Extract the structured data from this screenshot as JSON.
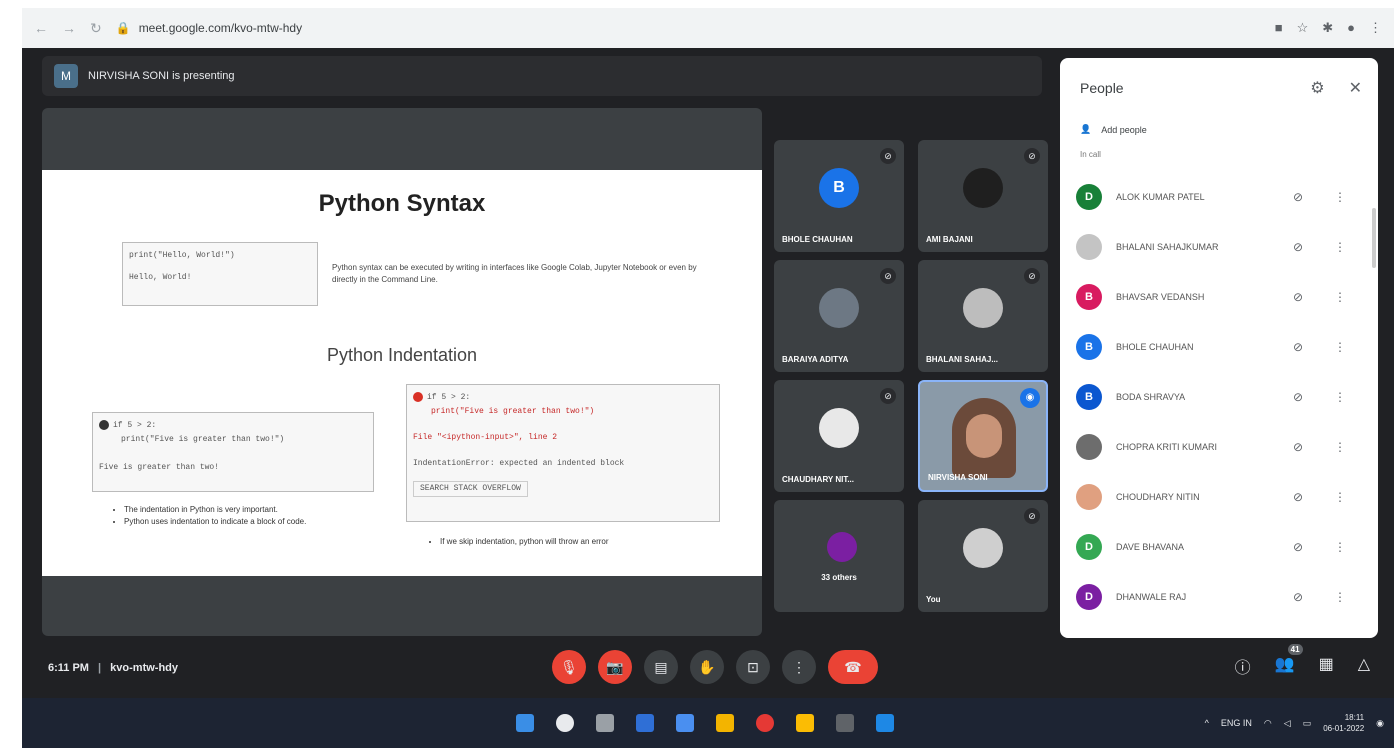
{
  "browser": {
    "url": "meet.google.com/kvo-mtw-hdy",
    "back": "←",
    "forward": "→",
    "reload": "↻"
  },
  "presenter": {
    "logo_text": "M",
    "label": "NIRVISHA SONI is presenting"
  },
  "slide": {
    "title": "Python Syntax",
    "code1": "print(\"Hello, World!\")",
    "code1_out": "Hello, World!",
    "syntax_desc": "Python syntax can be executed by writing in interfaces like Google Colab, Jupyter Notebook or even by directly in the Command Line.",
    "subtitle": "Python Indentation",
    "code2_line1": "if 5 > 2:",
    "code2_line2": "print(\"Five is greater than two!\")",
    "code2_out": "Five is greater than two!",
    "code3_line1": "if 5 > 2:",
    "code3_line2": "print(\"Five is greater than two!\")",
    "code3_err1": "File \"<ipython-input>\", line 2",
    "code3_err2": "IndentationError: expected an indented block",
    "code3_link": "SEARCH STACK OVERFLOW",
    "bullet1": "The indentation in Python is very important.",
    "bullet2": "Python uses indentation to indicate a block of code.",
    "bullet3": "If we skip indentation, python will throw an error"
  },
  "tiles": [
    {
      "name": "BHOLE CHAUHAN",
      "initial": "B",
      "color": "#1a73e8"
    },
    {
      "name": "AMI BAJANI",
      "initial": "",
      "color": "#3c4043"
    },
    {
      "name": "BARAIYA ADITYA",
      "initial": "",
      "color": "#6d7884"
    },
    {
      "name": "BHALANI SAHAJ...",
      "initial": "",
      "color": "#bdbdbd"
    },
    {
      "name": "CHAUDHARY NIT...",
      "initial": "",
      "color": "#e0a080"
    },
    {
      "name": "NIRVISHA SONI",
      "initial": "",
      "color": "#8a9aa8"
    },
    {
      "name": "33 others",
      "initial": "",
      "color": "#7b1fa2"
    },
    {
      "name": "You",
      "initial": "",
      "color": "#cfcfcf"
    }
  ],
  "people": {
    "title": "People",
    "add_people": "Add people",
    "in_call": "In call",
    "list": [
      {
        "name": "ALOK KUMAR PATEL",
        "initial": "D",
        "color": "#188038"
      },
      {
        "name": "BHALANI SAHAJKUMAR",
        "initial": "",
        "color": "#c4c4c4"
      },
      {
        "name": "BHAVSAR VEDANSH",
        "initial": "B",
        "color": "#d81b60"
      },
      {
        "name": "BHOLE CHAUHAN",
        "initial": "B",
        "color": "#1a73e8"
      },
      {
        "name": "BODA SHRAVYA",
        "initial": "B",
        "color": "#0b57d0"
      },
      {
        "name": "CHOPRA KRITI KUMARI",
        "initial": "",
        "color": "#6d6d6d"
      },
      {
        "name": "CHOUDHARY NITIN",
        "initial": "",
        "color": "#e0a080"
      },
      {
        "name": "DAVE BHAVANA",
        "initial": "D",
        "color": "#34a853"
      },
      {
        "name": "DHANWALE RAJ",
        "initial": "D",
        "color": "#7b1fa2"
      }
    ]
  },
  "meeting": {
    "time": "6:11 PM",
    "code": "kvo-mtw-hdy",
    "participant_count": "41"
  },
  "taskbar": {
    "lang": "ENG IN",
    "time": "18:11",
    "date": "06-01-2022"
  }
}
